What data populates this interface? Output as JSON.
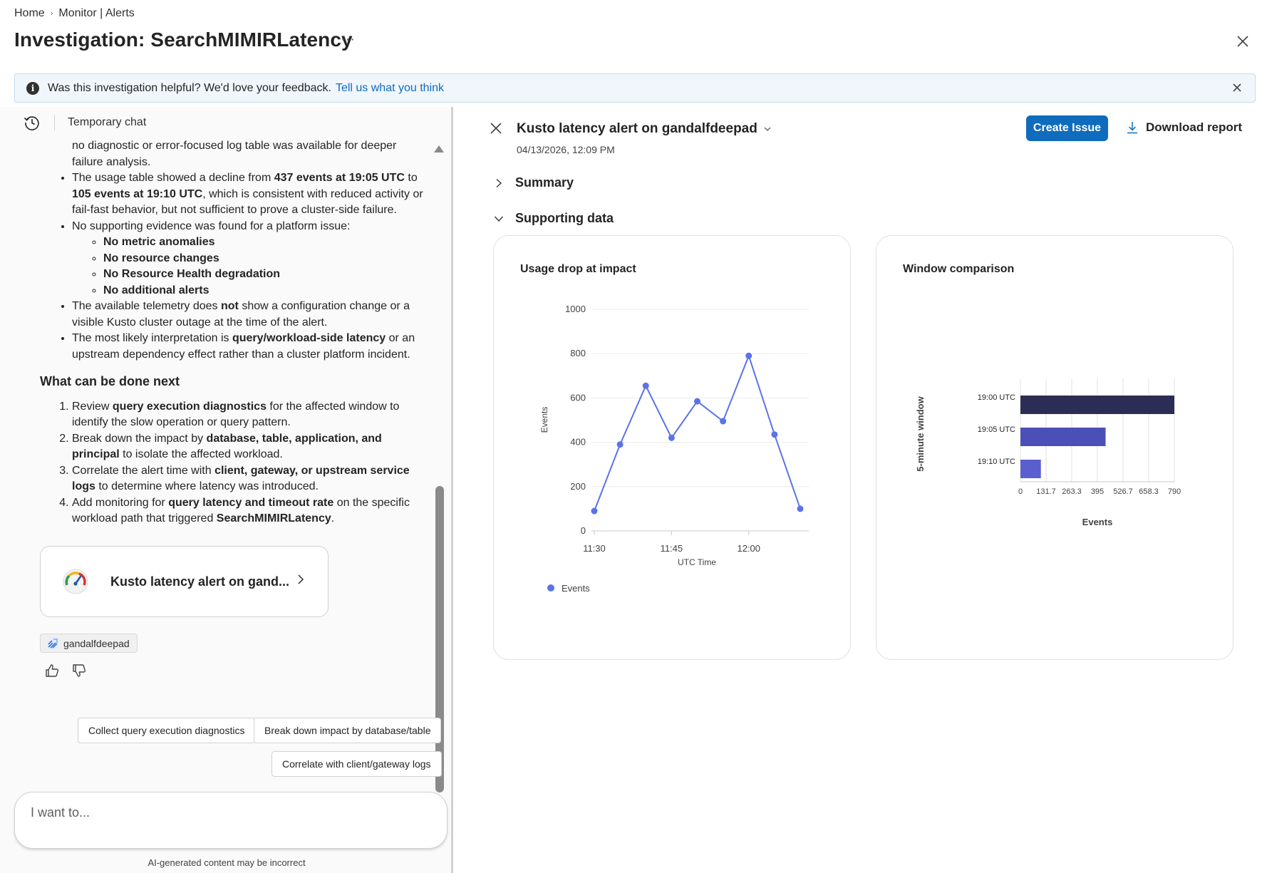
{
  "header": {
    "breadcrumb": [
      "Home",
      "Monitor | Alerts"
    ],
    "title": "Investigation: SearchMIMIRLatency",
    "more": "···"
  },
  "banner": {
    "text": "Was this investigation helpful? We'd love your feedback.",
    "link": "Tell us what you think"
  },
  "chat": {
    "header_label": "Temporary chat",
    "top_cont": "no diagnostic or error-focused log table was available for deeper failure analysis.",
    "b1_pre": "The usage table showed a decline from ",
    "b1_bold1": "437 events at 19:05 UTC",
    "b1_mid": " to ",
    "b1_bold2": "105 events at 19:10 UTC",
    "b1_post": ", which is consistent with reduced activity or fail-fast behavior, but not sufficient to prove a cluster-side failure.",
    "b2": "No supporting evidence was found for a platform issue:",
    "b2_sub": [
      "No metric anomalies",
      "No resource changes",
      "No Resource Health degradation",
      "No additional alerts"
    ],
    "b3_pre": "The available telemetry does ",
    "b3_bold": "not",
    "b3_post": " show a configuration change or a visible Kusto cluster outage at the time of the alert.",
    "b4_pre": "The most likely interpretation is ",
    "b4_bold": "query/workload-side latency",
    "b4_post": " or an upstream dependency effect rather than a cluster platform incident.",
    "next_heading": "What can be done next",
    "n1_pre": "Review ",
    "n1_bold": "query execution diagnostics",
    "n1_post": " for the affected window to identify the slow operation or query pattern.",
    "n2_pre": "Break down the impact by ",
    "n2_bold": "database, table, application, and principal",
    "n2_post": " to isolate the affected workload.",
    "n3_pre": "Correlate the alert time with ",
    "n3_bold": "client, gateway, or upstream service logs",
    "n3_post": " to determine where latency was introduced.",
    "n4_pre": "Add monitoring for ",
    "n4_bold": "query latency and timeout rate",
    "n4_post": " on the specific workload path that triggered ",
    "n4_bold2": "SearchMIMIRLatency",
    "n4_end": ".",
    "card_label": "Kusto latency alert on gand...",
    "chip_label": "gandalfdeepad",
    "suggestions": [
      "Collect query execution diagnostics",
      "Break down impact by database/table",
      "Correlate with client/gateway logs"
    ],
    "input_placeholder": "I want to...",
    "disclaimer": "AI-generated content may be incorrect"
  },
  "detail": {
    "title": "Kusto latency alert on gandalfdeepad",
    "date": "04/13/2026, 12:09 PM",
    "create_label": "Create Issue",
    "download_label": "Download report",
    "summary_label": "Summary",
    "supporting_label": "Supporting data"
  },
  "colors": {
    "accent": "#0f6cbd",
    "line": "#5b73e8",
    "bar_dark": "#2b2d55",
    "bar_mid": "#4b4fb8",
    "bar_light": "#5a5fcf"
  },
  "chart_data": [
    {
      "type": "line",
      "title": "Usage drop at impact",
      "xlabel": "UTC Time",
      "ylabel": "Events",
      "x_ticks": [
        "11:30",
        "11:45",
        "12:00"
      ],
      "y_ticks": [
        0,
        200,
        400,
        600,
        800,
        1000
      ],
      "ylim": [
        0,
        1000
      ],
      "x_minutes": [
        0,
        5,
        10,
        15,
        20,
        25,
        30,
        35,
        40
      ],
      "series": [
        {
          "name": "Events",
          "values": [
            90,
            390,
            655,
            420,
            585,
            495,
            790,
            435,
            100
          ]
        }
      ],
      "legend": "bottom-left",
      "grid": true
    },
    {
      "type": "bar",
      "orientation": "horizontal",
      "title": "Window comparison",
      "xlabel": "Events",
      "ylabel": "5-minute window",
      "categories": [
        "19:00 UTC",
        "19:05 UTC",
        "19:10 UTC"
      ],
      "values": [
        790,
        437,
        105
      ],
      "x_ticks": [
        "0",
        "131.7",
        "263.3",
        "395",
        "526.7",
        "658.3",
        "790"
      ],
      "xlim": [
        0,
        790
      ],
      "grid": true
    }
  ]
}
